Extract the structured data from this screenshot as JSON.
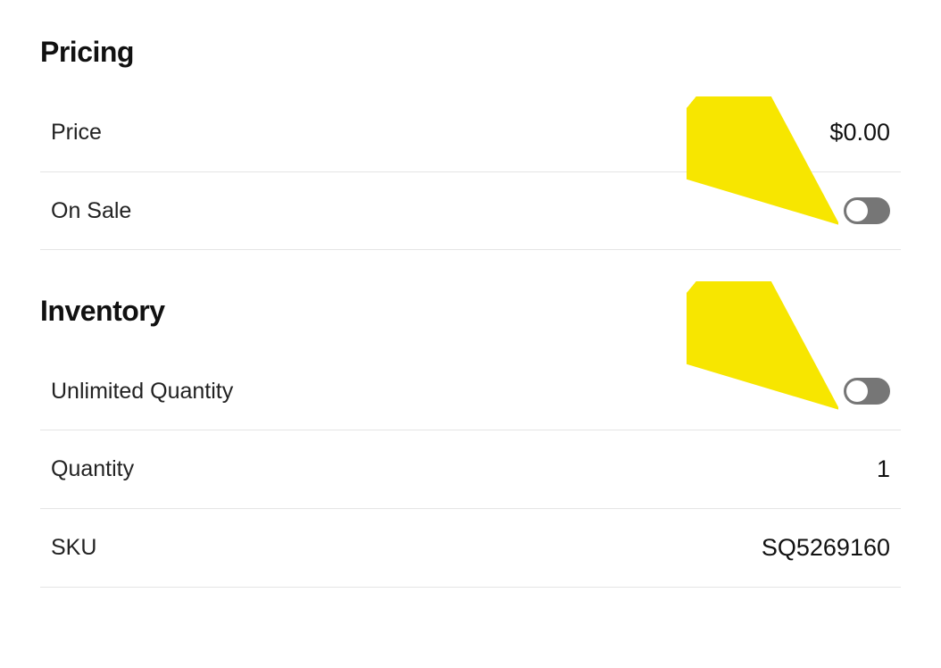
{
  "pricing": {
    "title": "Pricing",
    "price_label": "Price",
    "price_value": "$0.00",
    "on_sale_label": "On Sale",
    "on_sale_enabled": false
  },
  "inventory": {
    "title": "Inventory",
    "unlimited_label": "Unlimited Quantity",
    "unlimited_enabled": false,
    "quantity_label": "Quantity",
    "quantity_value": "1",
    "sku_label": "SKU",
    "sku_value": "SQ5269160"
  }
}
